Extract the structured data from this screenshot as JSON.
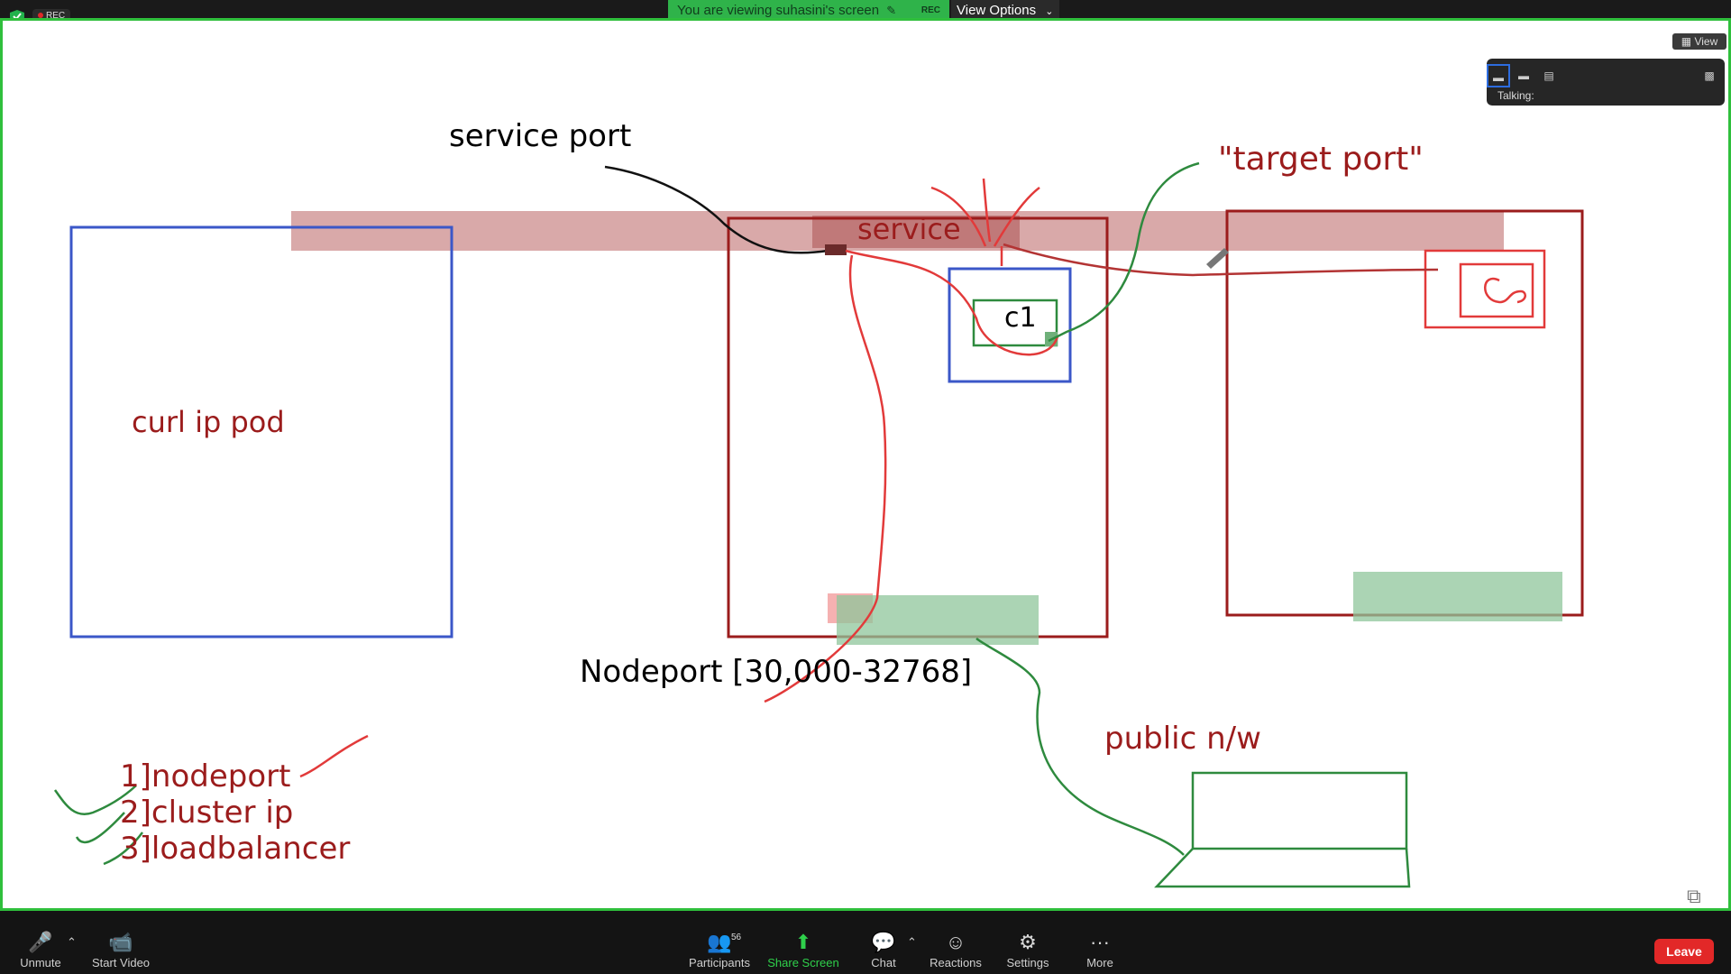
{
  "header": {
    "rec": "REC",
    "viewing_text": "You are viewing suhasini's screen",
    "share_rec": "REC",
    "view_options": "View Options"
  },
  "view": {
    "label": "View",
    "talking_label": "Talking:"
  },
  "whiteboard": {
    "service_port": "service port",
    "target_port": "\"target port\"",
    "service": "service",
    "c1": "c1",
    "curl_text": "curl  ip pod",
    "nodeport": "Nodeport [30,000-32768]",
    "public_nw": "public n/w",
    "list": [
      "1]nodeport",
      "2]cluster ip",
      "3]loadbalancer"
    ]
  },
  "toolbar": {
    "unmute": "Unmute",
    "start_video": "Start Video",
    "participants": "Participants",
    "participants_count": "56",
    "share_screen": "Share Screen",
    "chat": "Chat",
    "reactions": "Reactions",
    "settings": "Settings",
    "more": "More",
    "leave": "Leave"
  },
  "colors": {
    "accent_green": "#2fbf3c",
    "leave_red": "#e22828",
    "ink_red": "#9b1c1c",
    "ink_blue": "#3b57c8",
    "ink_green": "#2e8a3e"
  }
}
